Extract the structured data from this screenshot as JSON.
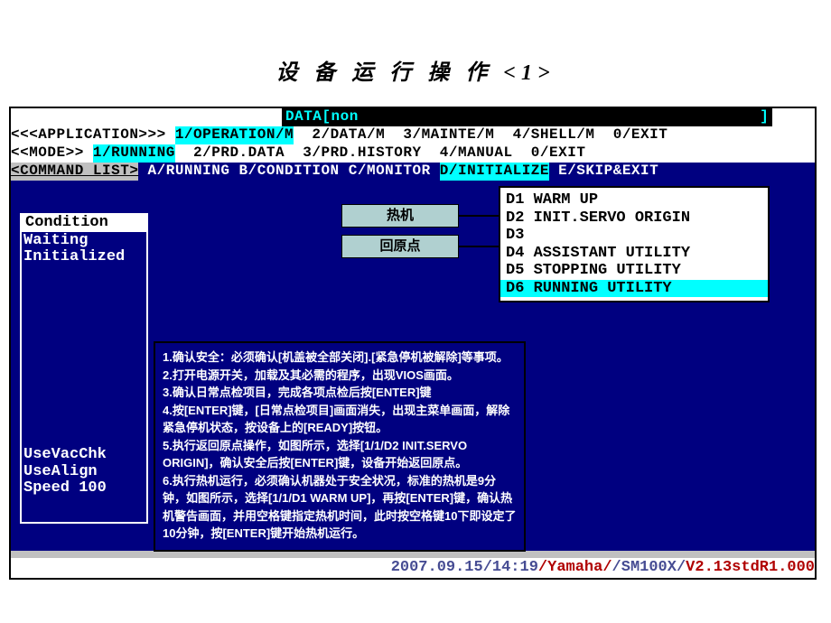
{
  "page_title": "设 备 运 行 操 作 <1>",
  "data_line": "DATA[non                                            ]",
  "app_row": {
    "label": "<<<APPLICATION>>> ",
    "hilite": "1/OPERATION/M",
    "rest": "  2/DATA/M  3/MAINTE/M  4/SHELL/M  0/EXIT"
  },
  "mode_row": {
    "label": "<<MODE>> ",
    "hilite": "1/RUNNING",
    "rest": "  2/PRD.DATA  3/PRD.HISTORY  4/MANUAL  0/EXIT"
  },
  "cmd_row": {
    "label": "<COMMAND LIST>",
    "before": " A/RUNNING B/CONDITION C/MONITOR ",
    "hilite": "D/INITIALIZE",
    "after": " E/SKIP&EXIT"
  },
  "side": {
    "head": "Condition",
    "lines_top": [
      "Waiting",
      "Initialized"
    ],
    "lines_bottom": [
      "UseVacChk",
      "UseAlign",
      "Speed 100"
    ]
  },
  "popup1": "热机",
  "popup2": "回原点",
  "menu": [
    {
      "txt": "D1 WARM UP",
      "hl": false
    },
    {
      "txt": "D2 INIT.SERVO ORIGIN",
      "hl": false
    },
    {
      "txt": "D3",
      "hl": false
    },
    {
      "txt": "D4 ASSISTANT UTILITY",
      "hl": false
    },
    {
      "txt": "D5 STOPPING UTILITY",
      "hl": false
    },
    {
      "txt": "D6 RUNNING UTILITY",
      "hl": true
    }
  ],
  "instructions": "1.确认安全：必须确认[机盖被全部关闭].[紧急停机被解除]等事项。\n2.打开电源开关，加载及其必需的程序，出现VIOS画面。\n3.确认日常点检项目，完成各项点检后按[ENTER]键\n4.按[ENTER]键，[日常点检项目]画面消失，出现主菜单画面，解除紧急停机状态，按设备上的[READY]按钮。\n5.执行返回原点操作，如图所示，选择[1/1/D2 INIT.SERVO ORIGIN]，确认安全后按[ENTER]键，设备开始返回原点。\n6.执行热机运行，必须确认机器处于安全状况，标准的热机是9分钟，如图所示，选择[1/1/D1 WARM UP]，再按[ENTER]键，确认热机警告画面，并用空格键指定热机时间，此时按空格键10下即设定了10分钟，按[ENTER]键开始热机运行。",
  "status": {
    "s1": "2007.09.15/14:19",
    "s2": "/Yamaha/",
    "s3": "/SM100X/",
    "s4": "V2.13stdR1.000"
  }
}
